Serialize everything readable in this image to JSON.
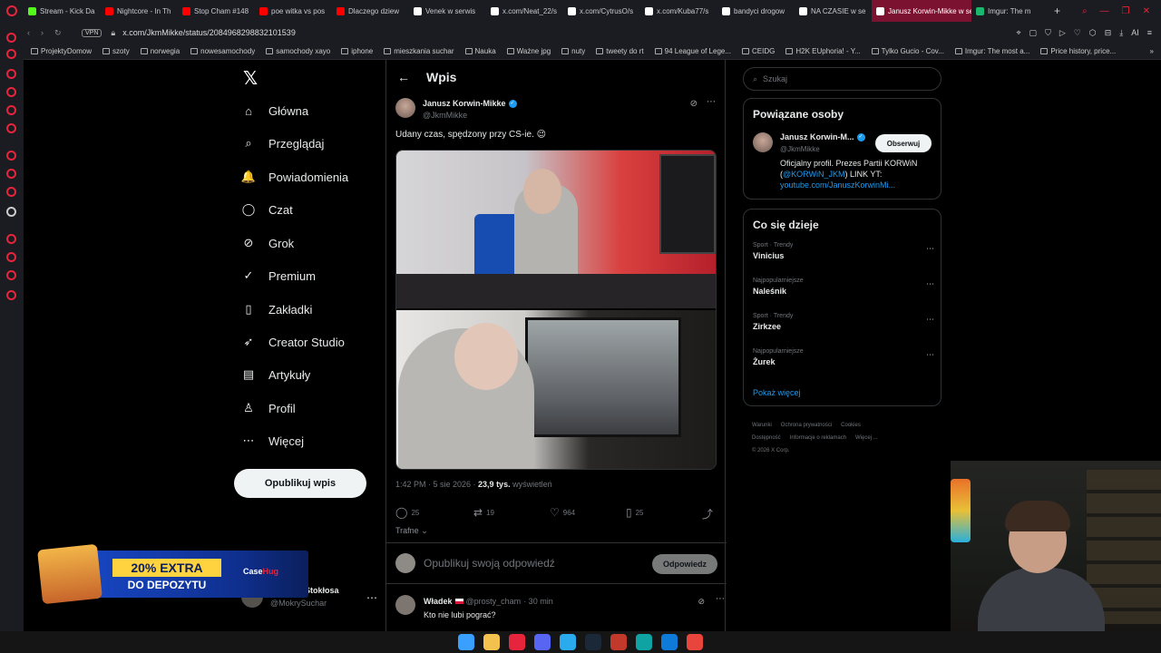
{
  "browser": {
    "tabs": [
      {
        "label": "Stream - Kick Da",
        "icon": "kick-icon",
        "color": "#53fc18"
      },
      {
        "label": "Nightcore - In Th",
        "icon": "youtube-icon",
        "color": "#ff0000"
      },
      {
        "label": "Stop Cham #148",
        "icon": "youtube-icon",
        "color": "#ff0000"
      },
      {
        "label": "poe witka vs pos",
        "icon": "youtube-icon",
        "color": "#ff0000"
      },
      {
        "label": "Dlaczego dziew",
        "icon": "youtube-icon",
        "color": "#ff0000"
      },
      {
        "label": "Venek w serwis",
        "icon": "x-icon",
        "color": "#ffffff"
      },
      {
        "label": "x.com/Neat_22/s",
        "icon": "x-icon",
        "color": "#ffffff"
      },
      {
        "label": "x.com/CytrusO/s",
        "icon": "x-icon",
        "color": "#ffffff"
      },
      {
        "label": "x.com/Kuba77/s",
        "icon": "x-icon",
        "color": "#ffffff"
      },
      {
        "label": "bandyci drogow",
        "icon": "x-icon",
        "color": "#ffffff"
      },
      {
        "label": "NA CZASIE w se",
        "icon": "x-icon",
        "color": "#ffffff"
      },
      {
        "label": "Janusz Korwin-Mikke w se",
        "icon": "x-icon",
        "color": "#ffffff",
        "active": true
      },
      {
        "label": "Imgur: The m",
        "icon": "imgur-icon",
        "color": "#1bb76e"
      }
    ],
    "url": "x.com/JkmMikke/status/2084968298832101539",
    "vpn_label": "VPN",
    "bookmarks": [
      "ProjektyDomow",
      "szoty",
      "norwegia",
      "nowesamochody",
      "samochody xayo",
      "iphone",
      "mieszkania suchar",
      "Nauka",
      "Ważne jpg",
      "nuty",
      "tweety do rt",
      "94 League of Lege...",
      "CEIDG",
      "H2K EUphoria! - Y...",
      "Tylko Gucio - Cov...",
      "Imgur: The most a...",
      "Price history, price..."
    ],
    "ai_label": "AI"
  },
  "nav": {
    "items": [
      {
        "label": "Główna",
        "icon": "home-icon",
        "glyph": "⌂"
      },
      {
        "label": "Przeglądaj",
        "icon": "search-icon",
        "glyph": "⌕"
      },
      {
        "label": "Powiadomienia",
        "icon": "bell-icon",
        "glyph": "🔔"
      },
      {
        "label": "Czat",
        "icon": "chat-icon",
        "glyph": "◯"
      },
      {
        "label": "Grok",
        "icon": "grok-icon",
        "glyph": "⊘"
      },
      {
        "label": "Premium",
        "icon": "premium-icon",
        "glyph": "✓"
      },
      {
        "label": "Zakładki",
        "icon": "bookmark-icon",
        "glyph": "▯"
      },
      {
        "label": "Creator Studio",
        "icon": "rocket-icon",
        "glyph": "➶"
      },
      {
        "label": "Artykuły",
        "icon": "articles-icon",
        "glyph": "▤"
      },
      {
        "label": "Profil",
        "icon": "profile-icon",
        "glyph": "♙"
      },
      {
        "label": "Więcej",
        "icon": "more-icon",
        "glyph": "⋯"
      }
    ],
    "post_button": "Opublikuj wpis",
    "me": {
      "name": "Dominik Stokłosa",
      "handle": "@MokrySuchar"
    }
  },
  "post": {
    "header_title": "Wpis",
    "author": {
      "name": "Janusz Korwin-Mikke",
      "handle": "@JkmMikke"
    },
    "text": "Udany czas, spędzony przy CS-ie. 😉",
    "time": "1:42 PM · 5 sie 2026 · ",
    "views_count": "23,9 tys.",
    "views_label": " wyświetleń",
    "stats": {
      "replies": "25",
      "reposts": "19",
      "likes": "964",
      "bookmarks": "25"
    },
    "sort_label": "Trafne",
    "reply_placeholder": "Opublikuj swoją odpowiedź",
    "reply_button": "Odpowiedz",
    "comment": {
      "name": "Władek",
      "handle": "@prosty_cham",
      "time": "· 30 min",
      "text": "Kto nie lubi pograć?"
    }
  },
  "sidebar": {
    "search_placeholder": "Szukaj",
    "related_title": "Powiązane osoby",
    "related": {
      "name": "Janusz Korwin-M...",
      "handle": "@JkmMikke",
      "follow": "Obserwuj",
      "bio_1": "Oficjalny profil. Prezes Partii KORWiN (",
      "bio_link": "@KORWiN_JKM",
      "bio_2": ") LINK YT: ",
      "bio_url": "youtube.com/JanuszKorwinMi..."
    },
    "trends_title": "Co się dzieje",
    "trends": [
      {
        "category": "Sport · Trendy",
        "title": "Vinicius"
      },
      {
        "category": "Najpopularniejsze",
        "title": "Naleśnik"
      },
      {
        "category": "Sport · Trendy",
        "title": "Zirkzee"
      },
      {
        "category": "Najpopularniejsze",
        "title": "Żurek"
      }
    ],
    "show_more": "Pokaż więcej",
    "footer": [
      "Warunki",
      "Ochrona prywatności",
      "Cookies",
      "Dostępność",
      "Informacje o reklamach",
      "Więcej ...",
      "© 2026 X Corp."
    ]
  },
  "overlay": {
    "ad_line1": "20% EXTRA",
    "ad_line2": "DO DEPOZYTU",
    "ad_brand_a": "Case",
    "ad_brand_b": "Hug"
  },
  "taskbar": [
    "windows-icon",
    "folder-icon",
    "opera-icon",
    "discord-icon",
    "telegram-icon",
    "steam-icon",
    "shield-icon",
    "app-icon",
    "edge-icon",
    "chrome-icon"
  ]
}
